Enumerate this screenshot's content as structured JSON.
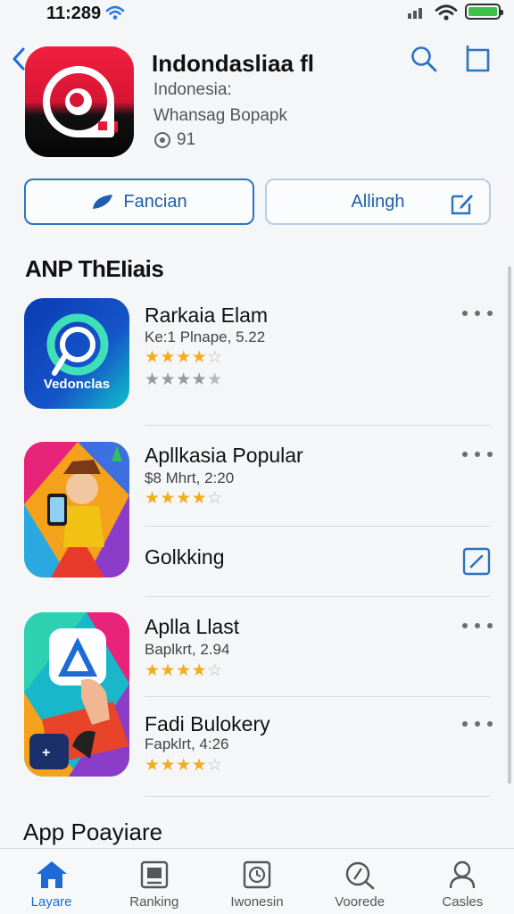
{
  "status_bar": {
    "time": "11:289"
  },
  "header": {
    "title": "Indondasliaa fl",
    "subtitle": "Indonesia:",
    "developer": "Whansag Bopapk",
    "rating": "91"
  },
  "actions": {
    "primary_label": "Fancian",
    "secondary_label": "Allingh"
  },
  "section_title": "ANP ThEIiais",
  "apps": [
    {
      "title": "Rarkaia Elam",
      "subtitle": "Ke:1 Plnape, 5.22",
      "thumb_text": "Vedonclas",
      "stars_colored": 4,
      "stars_grey": 4
    },
    {
      "title": "Apllkasia Popular",
      "subtitle": "$8 Mhrt, 2:20",
      "stars_colored": 4
    },
    {
      "title": "Golkking"
    },
    {
      "title": "Aplla Llast",
      "subtitle": "Baplkrt, 2.94",
      "stars_colored": 4
    },
    {
      "title": "Fadi Bulokery",
      "subtitle": "Fapklrt, 4:26",
      "stars_colored": 4
    }
  ],
  "bottom_section_title": "App Poayiare",
  "tabs": [
    {
      "label": "Layare",
      "icon": "home-icon",
      "active": true
    },
    {
      "label": "Ranking",
      "icon": "ranking-icon"
    },
    {
      "label": "Iwonesin",
      "icon": "clock-icon"
    },
    {
      "label": "Voorede",
      "icon": "compass-search-icon"
    },
    {
      "label": "Casles",
      "icon": "person-icon"
    }
  ],
  "colors": {
    "accent": "#1e6bd6",
    "star": "#f2ad1c",
    "battery": "#3cc24a"
  }
}
